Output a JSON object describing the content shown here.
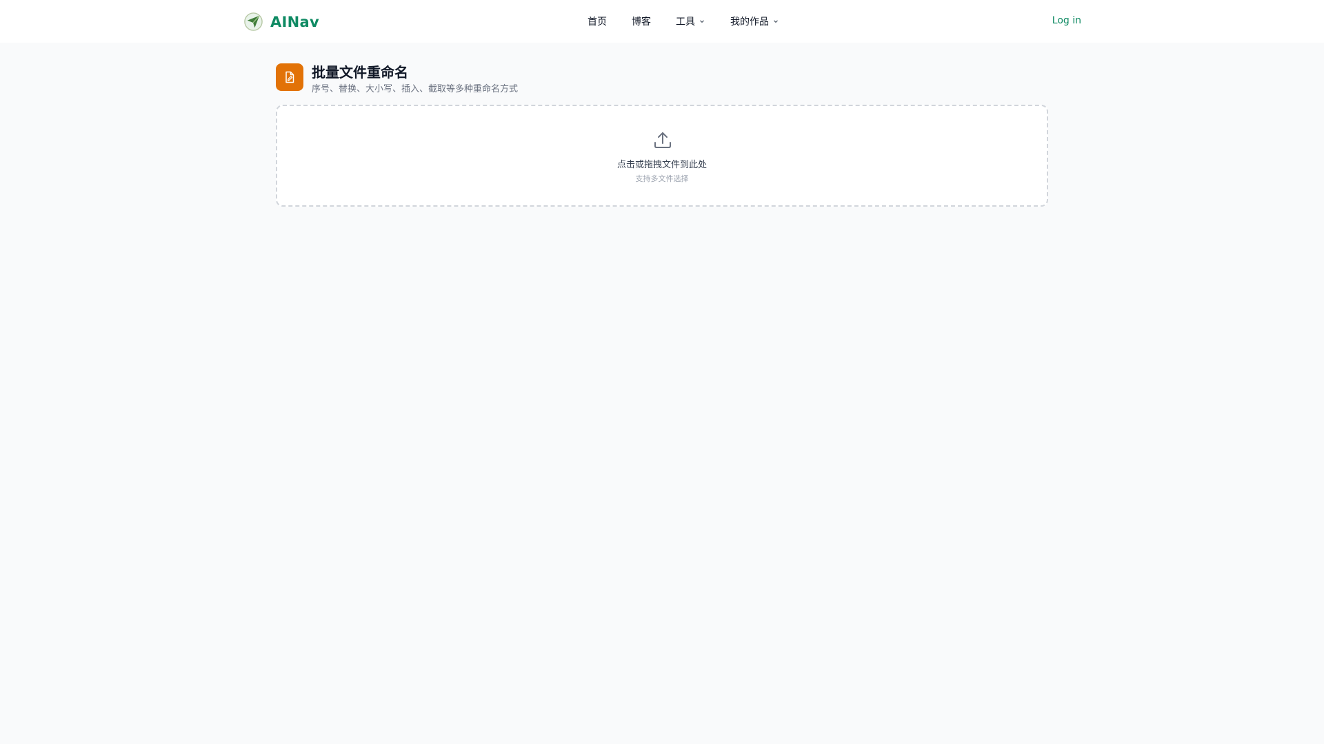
{
  "header": {
    "brand": "AINav",
    "nav": [
      {
        "label": "首页"
      },
      {
        "label": "博客"
      },
      {
        "label": "工具",
        "has_dropdown": true
      },
      {
        "label": "我的作品",
        "has_dropdown": true
      }
    ],
    "login_label": "Log in"
  },
  "tool": {
    "icon": "file-edit-icon",
    "title": "批量文件重命名",
    "subtitle": "序号、替换、大小写、插入、截取等多种重命名方式"
  },
  "dropzone": {
    "icon": "upload-icon",
    "main_text": "点击或拖拽文件到此处",
    "hint_text": "支持多文件选择"
  },
  "colors": {
    "brand": "#0f8a63",
    "tool_icon_bg": "#e27207",
    "page_bg": "#f9fafb"
  }
}
